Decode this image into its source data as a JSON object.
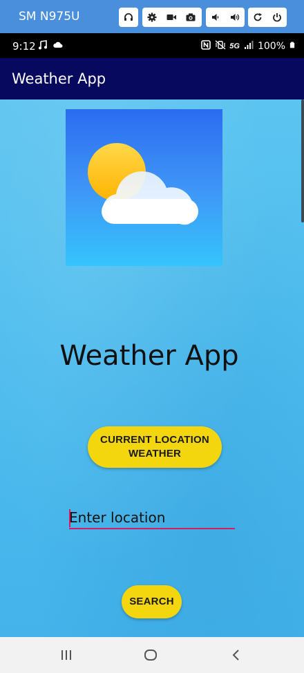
{
  "emulator": {
    "device_name": "SM N975U",
    "icons": [
      "headphones-icon",
      "settings-icon",
      "video-icon",
      "camera-icon",
      "volume-down-icon",
      "volume-up-icon",
      "rotate-icon",
      "power-icon"
    ]
  },
  "status_bar": {
    "time": "9:12",
    "battery": "100%",
    "network": "5G"
  },
  "app_bar": {
    "title": "Weather App"
  },
  "main": {
    "title": "Weather App",
    "current_location_button": "CURRENT LOCATION WEATHER",
    "location_input": {
      "placeholder": "Enter location",
      "value": ""
    },
    "search_button": "SEARCH"
  },
  "colors": {
    "app_bar": "#07095e",
    "accent_button": "#f4d60f",
    "input_underline": "#d81b60",
    "background": "#4dbcee"
  }
}
